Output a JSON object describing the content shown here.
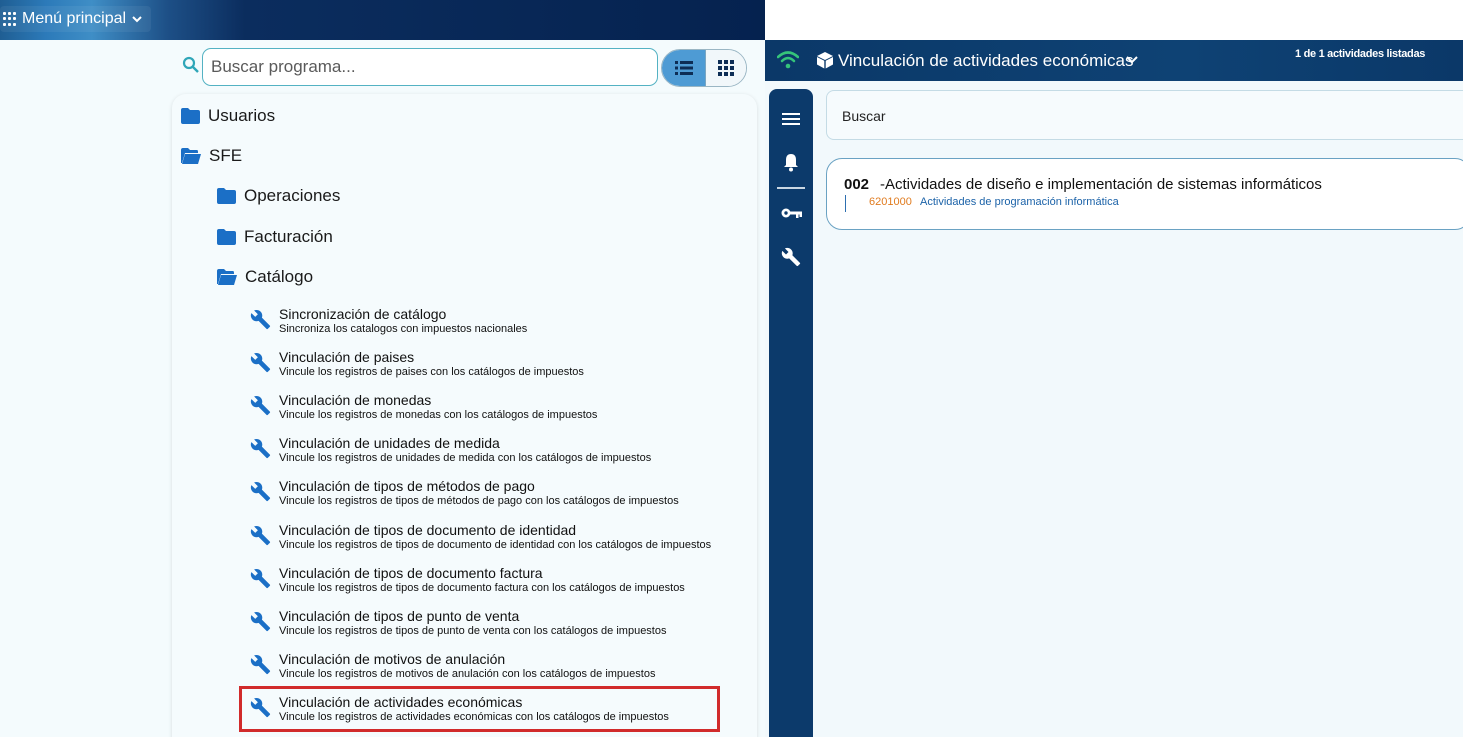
{
  "left": {
    "menu_label": "Menú principal",
    "search": {
      "placeholder": "Buscar programa...",
      "value": ""
    },
    "view_modes": {
      "list_icon": "list-icon",
      "grid_icon": "grid-icon",
      "active": "list"
    },
    "folders": [
      {
        "label": "Usuarios",
        "state": "closed"
      },
      {
        "label": "SFE",
        "state": "open"
      },
      {
        "label": "Operaciones",
        "state": "closed"
      },
      {
        "label": "Facturación",
        "state": "closed"
      },
      {
        "label": "Catálogo",
        "state": "open"
      }
    ],
    "programs": [
      {
        "title": "Sincronización de catálogo",
        "desc": "Sincroniza los catalogos con impuestos nacionales"
      },
      {
        "title": "Vinculación de paises",
        "desc": "Vincule los registros de paises con los catálogos de impuestos"
      },
      {
        "title": "Vinculación de monedas",
        "desc": "Vincule los registros de monedas con los catálogos de impuestos"
      },
      {
        "title": "Vinculación de unidades de medida",
        "desc": "Vincule los registros de unidades de medida con los catálogos de impuestos"
      },
      {
        "title": "Vinculación de tipos de métodos de pago",
        "desc": "Vincule los registros de tipos de métodos de pago con los catálogos de impuestos"
      },
      {
        "title": "Vinculación de tipos de documento de identidad",
        "desc": "Vincule los registros de tipos de documento de identidad con los catálogos de impuestos"
      },
      {
        "title": "Vinculación de tipos de documento factura",
        "desc": "Vincule los registros de tipos de documento factura con los catálogos de impuestos"
      },
      {
        "title": "Vinculación de tipos de punto de venta",
        "desc": "Vincule los registros de tipos de punto de venta con los catálogos de impuestos"
      },
      {
        "title": "Vinculación de motivos de anulación",
        "desc": "Vincule los registros de motivos de anulación con los catálogos de impuestos"
      },
      {
        "title": "Vinculación de actividades económicas",
        "desc": "Vincule los registros de actividades económicas con los catálogos de impuestos"
      }
    ],
    "highlighted_program": "Vinculación de actividades económicas"
  },
  "right": {
    "title": "Vinculación de actividades económicas",
    "count": "1 de 1 actividades listadas",
    "search_placeholder": "Buscar",
    "rail_icons": [
      "menu-icon",
      "bell-icon",
      "key-icon",
      "wrench-icon"
    ],
    "activity": {
      "code": "002",
      "name": "-Actividades de diseño e implementación de sistemas informáticos",
      "sub_code": "6201000",
      "sub_name": "Actividades de programación informática"
    }
  },
  "colors": {
    "accent_blue": "#1b6fc6",
    "header_navy": "#0b3868",
    "highlight_red": "#d12b2b",
    "wifi_green": "#35c47a",
    "code_orange": "#e07b1f"
  }
}
